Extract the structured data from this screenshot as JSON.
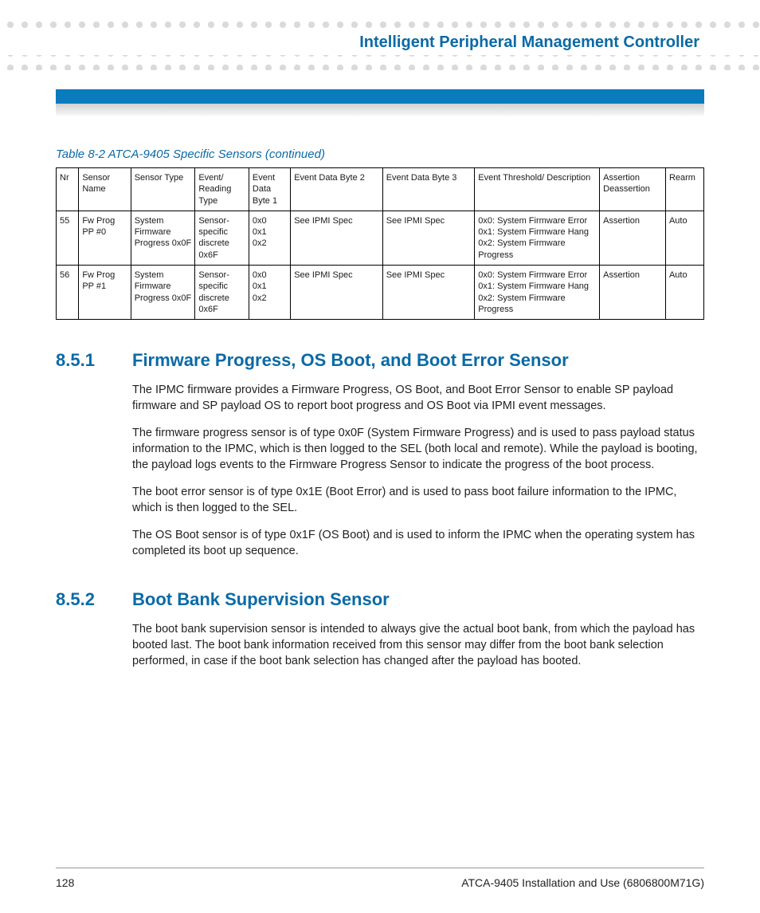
{
  "header": {
    "title": "Intelligent Peripheral Management Controller"
  },
  "table": {
    "caption": "Table 8-2 ATCA-9405 Specific Sensors (continued)",
    "headers": {
      "nr": "Nr",
      "name": "Sensor Name",
      "type": "Sensor Type",
      "reading": "Event/ Reading Type",
      "b1": "Event Data Byte 1",
      "b2": "Event Data Byte 2",
      "b3": "Event Data Byte 3",
      "thr": "Event Threshold/ Description",
      "ad": "Assertion Deassertion",
      "rearm": "Rearm"
    },
    "rows": [
      {
        "nr": "55",
        "name": "Fw Prog PP #0",
        "type": "System Firmware Progress 0x0F",
        "reading": "Sensor-specific discrete 0x6F",
        "b1": "0x0\n0x1\n0x2",
        "b2": "See IPMI Spec",
        "b3": "See IPMI Spec",
        "thr": "0x0: System Firmware Error\n0x1: System Firmware Hang\n0x2: System Firmware Progress",
        "ad": "Assertion",
        "rearm": "Auto"
      },
      {
        "nr": "56",
        "name": "Fw Prog PP #1",
        "type": "System Firmware Progress 0x0F",
        "reading": "Sensor-specific discrete 0x6F",
        "b1": "0x0\n0x1\n0x2",
        "b2": "See IPMI Spec",
        "b3": "See IPMI Spec",
        "thr": "0x0: System Firmware Error\n0x1: System Firmware Hang\n0x2: System Firmware Progress",
        "ad": "Assertion",
        "rearm": "Auto"
      }
    ]
  },
  "sections": [
    {
      "num": "8.5.1",
      "title": "Firmware Progress, OS Boot, and Boot Error Sensor",
      "paras": [
        "The IPMC firmware provides a Firmware Progress, OS Boot, and Boot Error Sensor to enable SP payload firmware and SP payload OS to report boot progress and OS Boot via IPMI event messages.",
        "The firmware progress sensor is of type 0x0F (System Firmware Progress) and is used to pass payload status information to the IPMC, which is then logged to the SEL (both local and remote). While the payload is booting, the payload logs events to the Firmware Progress Sensor to indicate the progress of the boot process.",
        "The boot error sensor is of type 0x1E (Boot Error) and is used to pass boot failure information to the IPMC, which is then logged to the SEL.",
        "The OS Boot sensor is of type 0x1F (OS Boot) and is used to inform the IPMC when the operating system has completed its boot up sequence."
      ]
    },
    {
      "num": "8.5.2",
      "title": "Boot Bank Supervision Sensor",
      "paras": [
        "The boot bank supervision sensor is intended to always give the actual boot bank, from which the payload has booted last. The boot bank information received from this sensor may differ from the boot bank selection performed, in case if the boot bank selection has changed after the payload has booted."
      ]
    }
  ],
  "footer": {
    "page": "128",
    "doc": "ATCA-9405 Installation and Use (6806800M71G)"
  }
}
